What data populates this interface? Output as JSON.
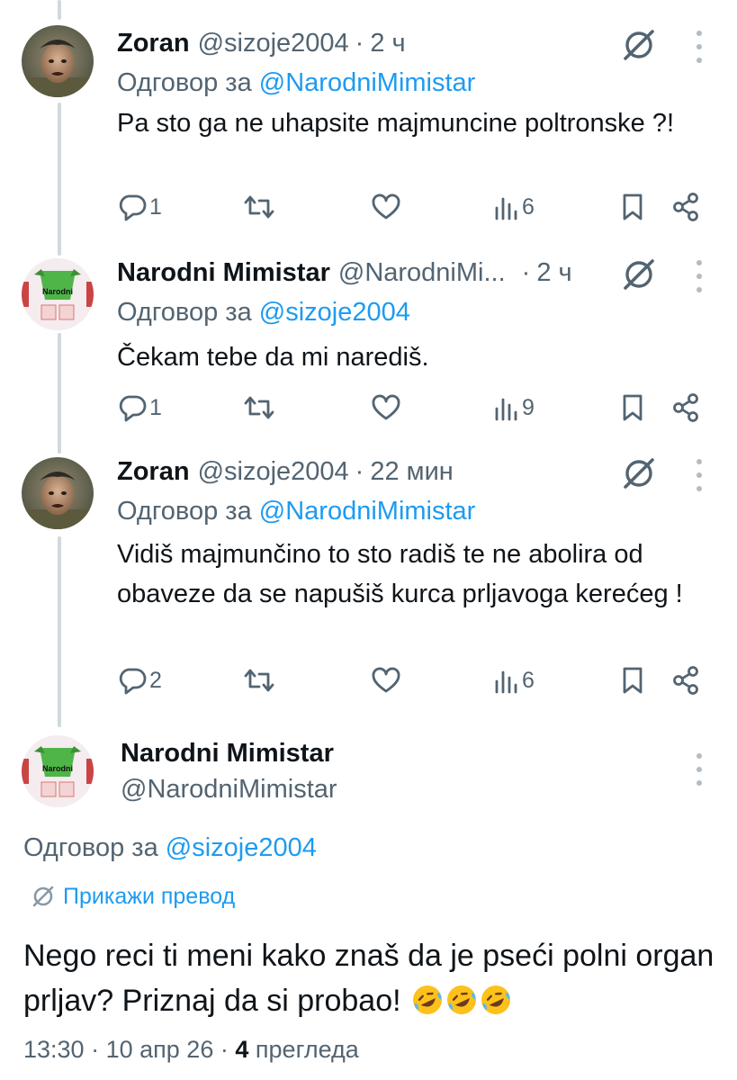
{
  "thread": [
    {
      "name": "Zoran",
      "handle": "@sizoje2004",
      "separator": "·",
      "time": "2 ч",
      "reply_prefix": "Одговор за",
      "reply_to": "@NarodniMimistar",
      "text": "Pa sto ga ne uhapsite majmuncine poltronske ?!",
      "replies": "1",
      "views": "6",
      "avatar": "avatar-zoran"
    },
    {
      "name": "Narodni Mimistar",
      "handle": "@NarodniMi...",
      "separator": "·",
      "time": "2 ч",
      "reply_prefix": "Одговор за",
      "reply_to": "@sizoje2004",
      "text": "Čekam tebe da mi narediš.",
      "replies": "1",
      "views": "9",
      "avatar": "avatar-narodni"
    },
    {
      "name": "Zoran",
      "handle": "@sizoje2004",
      "separator": "·",
      "time": "22 мин",
      "reply_prefix": "Одговор за",
      "reply_to": "@NarodniMimistar",
      "text": "Vidiš majmunčino to sto radiš te ne abolira od obaveze da se napušiš kurca prljavoga kerećeg !",
      "replies": "2",
      "views": "6",
      "avatar": "avatar-zoran"
    }
  ],
  "main": {
    "name": "Narodni Mimistar",
    "handle": "@NarodniMimistar",
    "reply_prefix": "Одговор за",
    "reply_to": "@sizoje2004",
    "translate_label": "Прикажи превод",
    "text": "Nego reci ti meni kako znaš da je pseći polni organ prljav? Priznaj da si probao!",
    "emoji": "🤣🤣🤣",
    "time": "13:30",
    "separator": "·",
    "date": "10 апр 26",
    "views_count": "4",
    "views_label": "прегледа"
  },
  "icons": {
    "reply": "reply-icon",
    "retweet": "retweet-icon",
    "like": "like-icon",
    "views": "views-icon",
    "bookmark": "bookmark-icon",
    "share": "share-icon",
    "grok": "grok-icon",
    "more": "more-icon",
    "translate": "translate-icon"
  },
  "colors": {
    "link": "#1d9bf0",
    "muted": "#536471",
    "text": "#0f1419",
    "thread_line": "#cfd9de"
  }
}
